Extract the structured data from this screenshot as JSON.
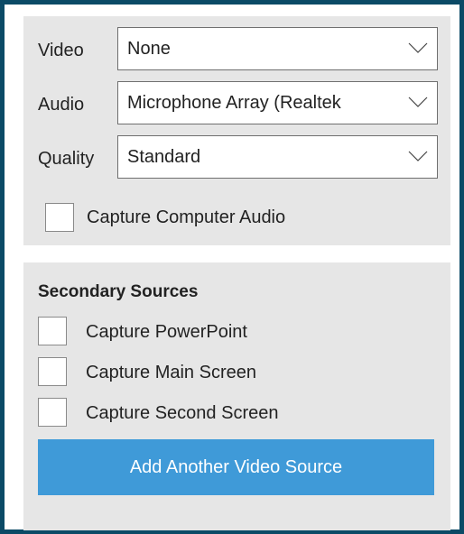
{
  "primary_sources": {
    "video": {
      "label": "Video",
      "value": "None"
    },
    "audio": {
      "label": "Audio",
      "value": "Microphone Array (Realtek"
    },
    "quality": {
      "label": "Quality",
      "value": "Standard"
    },
    "capture_computer_audio": {
      "label": "Capture Computer Audio",
      "checked": false
    }
  },
  "secondary_sources": {
    "title": "Secondary Sources",
    "checkboxes": [
      {
        "label": "Capture PowerPoint",
        "checked": false
      },
      {
        "label": "Capture Main Screen",
        "checked": false
      },
      {
        "label": "Capture Second Screen",
        "checked": false
      }
    ],
    "add_button_label": "Add Another Video Source"
  },
  "icons": {
    "dropdown": "chevron-down-icon"
  },
  "colors": {
    "frame_border": "#0b4a66",
    "panel_background": "#e6e6e6",
    "button_background": "#3f9ad8",
    "button_text": "#ffffff"
  }
}
